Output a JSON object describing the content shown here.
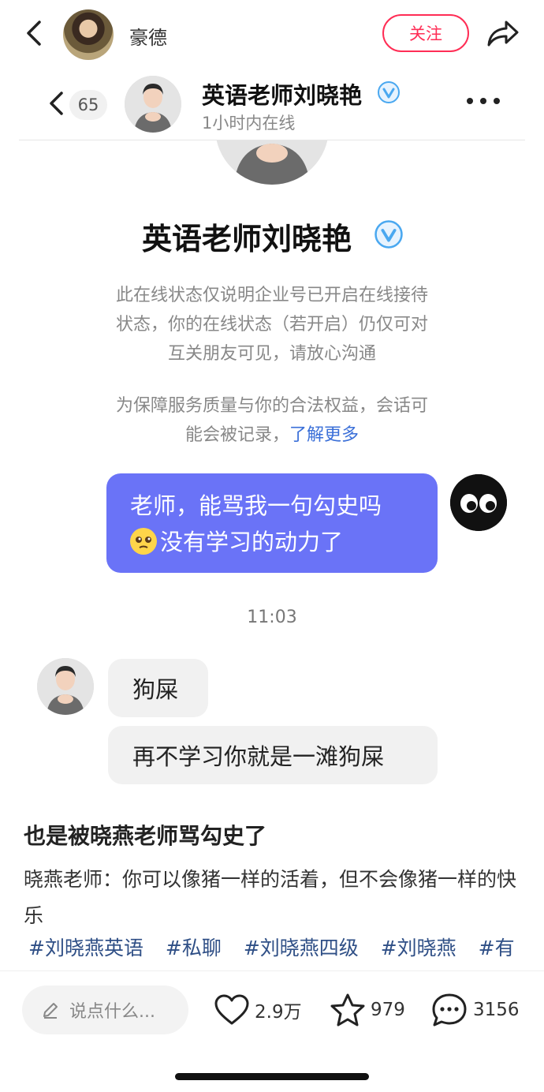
{
  "topbar": {
    "author_name": "豪德",
    "follow_label": "关注"
  },
  "chat_header": {
    "unread_count": "65",
    "contact_name": "英语老师刘晓艳",
    "contact_status": "1小时内在线"
  },
  "profile": {
    "name": "英语老师刘晓艳"
  },
  "notices": {
    "online_line1": "此在线状态仅说明企业号已开启在线接待",
    "online_line2": "状态，你的在线状态（若开启）仍仅可对",
    "online_line3": "互关朋友可见，请放心沟通",
    "record_line1": "为保障服务质量与你的合法权益，会话可",
    "record_line2": "能会被记录，",
    "learn_more": "了解更多"
  },
  "messages": {
    "sent_line1": "老师，能骂我一句勾史吗",
    "sent_line2": "没有学习的动力了",
    "time": "11:03",
    "recv_1": "狗屎",
    "recv_2": "再不学习你就是一滩狗屎"
  },
  "post": {
    "title": "也是被晓燕老师骂勾史了",
    "body": "晓燕老师：你可以像猪一样的活着，但不会像猪一样的快乐",
    "tags": [
      "#刘晓燕英语",
      "#私聊",
      "#刘晓燕四级",
      "#刘晓燕",
      "#有"
    ]
  },
  "bottom_bar": {
    "comment_placeholder": "说点什么...",
    "likes": "2.9万",
    "favorites": "979",
    "comments": "3156"
  },
  "colors": {
    "accent_red": "#ff2d55",
    "sent_bubble": "#6a73f7",
    "link_blue": "#3a6fd8",
    "tag_blue": "#2f4f86",
    "verify_blue": "#4aa8f0"
  },
  "icons": [
    "back-icon",
    "share-icon",
    "verified-icon",
    "more-icon",
    "edit-icon",
    "heart-icon",
    "star-icon",
    "comment-icon"
  ]
}
